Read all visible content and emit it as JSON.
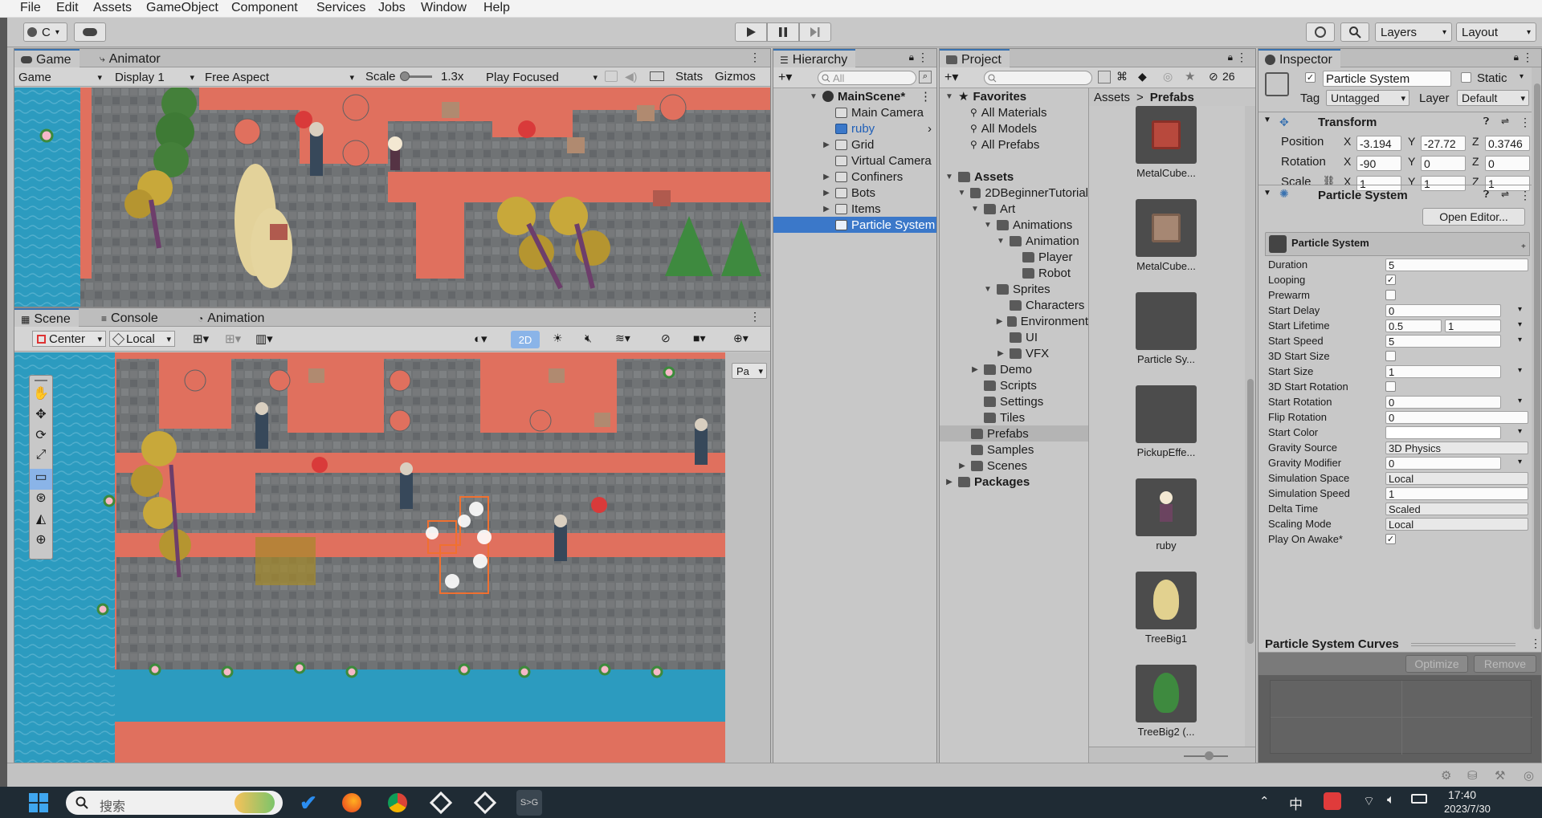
{
  "menu": [
    "File",
    "Edit",
    "Assets",
    "GameObject",
    "Component",
    "Services",
    "Jobs",
    "Window",
    "Help"
  ],
  "toolbar": {
    "account_label": "C",
    "play_icon": "play-icon",
    "pause_icon": "pause-icon",
    "step_icon": "step-icon",
    "layers_label": "Layers",
    "layout_label": "Layout"
  },
  "game": {
    "tabs": [
      "Game",
      "Animator"
    ],
    "view_select": "Game",
    "display": "Display 1",
    "aspect": "Free Aspect",
    "scale_label": "Scale",
    "scale_value": "1.3x",
    "play_mode": "Play Focused",
    "stats": "Stats",
    "gizmos": "Gizmos"
  },
  "scene": {
    "tabs": [
      "Scene",
      "Console",
      "Animation"
    ],
    "pivot": "Center",
    "space": "Local",
    "mode_2d": "2D",
    "overlay_label": "Pa"
  },
  "hierarchy": {
    "title": "Hierarchy",
    "search_placeholder": "All",
    "root": "MainScene*",
    "items": [
      {
        "label": "Main Camera",
        "indent": 1,
        "fold": "",
        "icon": "cube"
      },
      {
        "label": "ruby",
        "indent": 1,
        "fold": "",
        "icon": "cube-blue",
        "blue": true,
        "arrow": true
      },
      {
        "label": "Grid",
        "indent": 1,
        "fold": "▶",
        "icon": "cube"
      },
      {
        "label": "Virtual Camera",
        "indent": 1,
        "fold": "",
        "icon": "cube"
      },
      {
        "label": "Confiners",
        "indent": 1,
        "fold": "▶",
        "icon": "cube"
      },
      {
        "label": "Bots",
        "indent": 1,
        "fold": "▶",
        "icon": "cube"
      },
      {
        "label": "Items",
        "indent": 1,
        "fold": "▶",
        "icon": "cube"
      },
      {
        "label": "Particle System",
        "indent": 1,
        "fold": "",
        "icon": "cube",
        "selected": true
      }
    ]
  },
  "project": {
    "title": "Project",
    "count": "26",
    "favorites_label": "Favorites",
    "favorites": [
      "All Materials",
      "All Models",
      "All Prefabs"
    ],
    "tree": [
      {
        "label": "Assets",
        "depth": 0,
        "fold": "▼",
        "bold": true
      },
      {
        "label": "2DBeginnerTutorial",
        "depth": 1,
        "fold": "▼"
      },
      {
        "label": "Art",
        "depth": 2,
        "fold": "▼"
      },
      {
        "label": "Animations",
        "depth": 3,
        "fold": "▼"
      },
      {
        "label": "Animation",
        "depth": 4,
        "fold": "▼"
      },
      {
        "label": "Player",
        "depth": 5,
        "fold": ""
      },
      {
        "label": "Robot",
        "depth": 5,
        "fold": ""
      },
      {
        "label": "Sprites",
        "depth": 3,
        "fold": "▼"
      },
      {
        "label": "Characters",
        "depth": 4,
        "fold": ""
      },
      {
        "label": "Environment",
        "depth": 4,
        "fold": "▶"
      },
      {
        "label": "UI",
        "depth": 4,
        "fold": ""
      },
      {
        "label": "VFX",
        "depth": 4,
        "fold": "▶"
      },
      {
        "label": "Demo",
        "depth": 2,
        "fold": "▶"
      },
      {
        "label": "Scripts",
        "depth": 2,
        "fold": ""
      },
      {
        "label": "Settings",
        "depth": 2,
        "fold": ""
      },
      {
        "label": "Tiles",
        "depth": 2,
        "fold": ""
      },
      {
        "label": "Prefabs",
        "depth": 1,
        "fold": "",
        "selected": true
      },
      {
        "label": "Samples",
        "depth": 1,
        "fold": ""
      },
      {
        "label": "Scenes",
        "depth": 1,
        "fold": "▶"
      },
      {
        "label": "Packages",
        "depth": 0,
        "fold": "▶",
        "bold": true
      }
    ],
    "breadcrumb": [
      "Assets",
      "Prefabs"
    ],
    "assets": [
      {
        "label": "MetalCube...",
        "kind": "metal-red"
      },
      {
        "label": "MetalCube...",
        "kind": "metal-brown"
      },
      {
        "label": "Particle Sy...",
        "kind": "blank"
      },
      {
        "label": "PickupEffe...",
        "kind": "blank"
      },
      {
        "label": "ruby",
        "kind": "ruby"
      },
      {
        "label": "TreeBig1",
        "kind": "tree-yellow"
      },
      {
        "label": "TreeBig2 (...",
        "kind": "tree-green"
      }
    ]
  },
  "inspector": {
    "title": "Inspector",
    "object_name": "Particle System",
    "static_label": "Static",
    "tag_label": "Tag",
    "tag_value": "Untagged",
    "layer_label": "Layer",
    "layer_value": "Default",
    "transform": {
      "title": "Transform",
      "position_label": "Position",
      "rotation_label": "Rotation",
      "scale_label": "Scale",
      "position": [
        "-3.194",
        "-27.72",
        "0.3746"
      ],
      "rotation": [
        "-90",
        "0",
        "0"
      ],
      "scale": [
        "1",
        "1",
        "1"
      ]
    },
    "ps_title": "Particle System",
    "open_editor": "Open Editor...",
    "module_title": "Particle System",
    "props": [
      {
        "label": "Duration",
        "type": "text",
        "value": "5"
      },
      {
        "label": "Looping",
        "type": "check",
        "value": "✓"
      },
      {
        "label": "Prewarm",
        "type": "check",
        "value": ""
      },
      {
        "label": "Start Delay",
        "type": "text",
        "value": "0",
        "menu": true
      },
      {
        "label": "Start Lifetime",
        "type": "range",
        "value": "0.5",
        "value2": "1",
        "menu": true
      },
      {
        "label": "Start Speed",
        "type": "text",
        "value": "5",
        "menu": true
      },
      {
        "label": "3D Start Size",
        "type": "check",
        "value": ""
      },
      {
        "label": "Start Size",
        "type": "text",
        "value": "1",
        "menu": true
      },
      {
        "label": "3D Start Rotation",
        "type": "check",
        "value": ""
      },
      {
        "label": "Start Rotation",
        "type": "text",
        "value": "0",
        "menu": true
      },
      {
        "label": "Flip Rotation",
        "type": "text",
        "value": "0"
      },
      {
        "label": "Start Color",
        "type": "color",
        "value": "",
        "menu": true
      },
      {
        "label": "Gravity Source",
        "type": "select",
        "value": "3D Physics"
      },
      {
        "label": "Gravity Modifier",
        "type": "text",
        "value": "0",
        "menu": true
      },
      {
        "label": "Simulation Space",
        "type": "select",
        "value": "Local"
      },
      {
        "label": "Simulation Speed",
        "type": "text",
        "value": "1"
      },
      {
        "label": "Delta Time",
        "type": "select",
        "value": "Scaled"
      },
      {
        "label": "Scaling Mode",
        "type": "select",
        "value": "Local"
      },
      {
        "label": "Play On Awake*",
        "type": "check",
        "value": "✓"
      }
    ],
    "curves_title": "Particle System Curves",
    "optimize": "Optimize",
    "remove": "Remove"
  },
  "taskbar": {
    "search_placeholder": "搜索",
    "ime": "中",
    "time": "17:40",
    "date": "2023/7/30"
  },
  "colors": {
    "accent": "#3b78c9",
    "water": "#2c9bbf",
    "floor": "#e0705e",
    "stone": "#6f7274"
  }
}
